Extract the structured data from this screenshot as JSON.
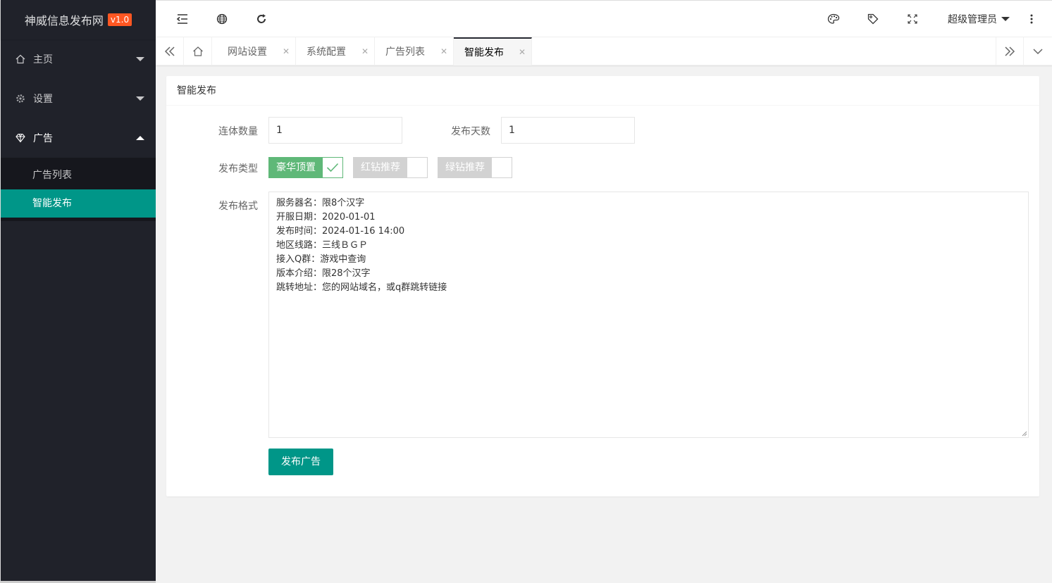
{
  "app": {
    "title": "神威信息发布网",
    "version": "v1.0"
  },
  "sidebar": {
    "items": [
      {
        "label": "主页",
        "icon": "home-icon"
      },
      {
        "label": "设置",
        "icon": "gear-icon"
      },
      {
        "label": "广告",
        "icon": "diamond-icon"
      }
    ],
    "sub_items": [
      {
        "label": "广告列表"
      },
      {
        "label": "智能发布"
      }
    ]
  },
  "header": {
    "user": "超级管理员"
  },
  "tabs": [
    {
      "label": "网站设置"
    },
    {
      "label": "系统配置"
    },
    {
      "label": "广告列表"
    },
    {
      "label": "智能发布"
    }
  ],
  "form": {
    "card_title": "智能发布",
    "count_label": "连体数量",
    "count_value": "1",
    "days_label": "发布天数",
    "days_value": "1",
    "type_label": "发布类型",
    "types": [
      {
        "label": "豪华顶置",
        "checked": true
      },
      {
        "label": "红钻推荐",
        "checked": false
      },
      {
        "label": "绿钻推荐",
        "checked": false
      }
    ],
    "format_label": "发布格式",
    "format_text": "服务器名：限8个汉字\n开服日期：2020-01-01\n发布时间：2024-01-16 14:00\n地区线路：三线ＢＧＰ\n接入Q群：游戏中查询\n版本介绍：限28个汉字\n跳转地址：您的网站域名，或q群跳转链接",
    "submit_label": "发布广告"
  },
  "colors": {
    "sidebar_bg": "#20222a",
    "accent": "#009688",
    "switch_on": "#5fb878",
    "version_badge": "#ff5722"
  }
}
